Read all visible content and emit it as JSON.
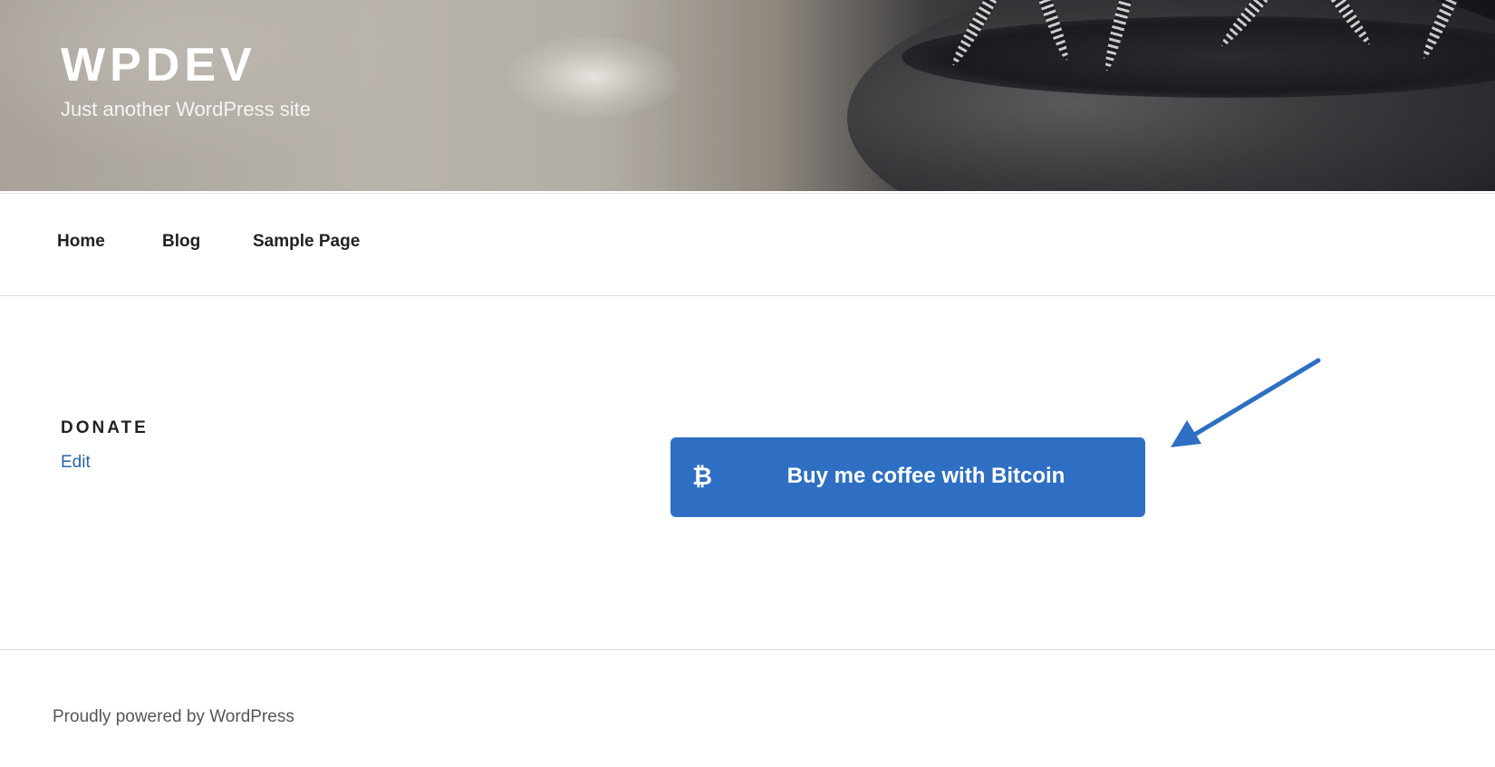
{
  "header": {
    "site_title": "WPDEV",
    "site_description": "Just another WordPress site"
  },
  "nav": {
    "items": [
      {
        "label": "Home"
      },
      {
        "label": "Blog"
      },
      {
        "label": "Sample Page"
      }
    ]
  },
  "main": {
    "widget_title": "DONATE",
    "edit_label": "Edit",
    "button": {
      "icon": "bitcoin-icon",
      "symbol": "₿",
      "label": "Buy me coffee with Bitcoin",
      "color": "#2e6fc3"
    },
    "annotation": {
      "icon": "arrow-pointer-icon",
      "color": "#2e6fc3"
    }
  },
  "footer": {
    "text": "Proudly powered by WordPress"
  }
}
